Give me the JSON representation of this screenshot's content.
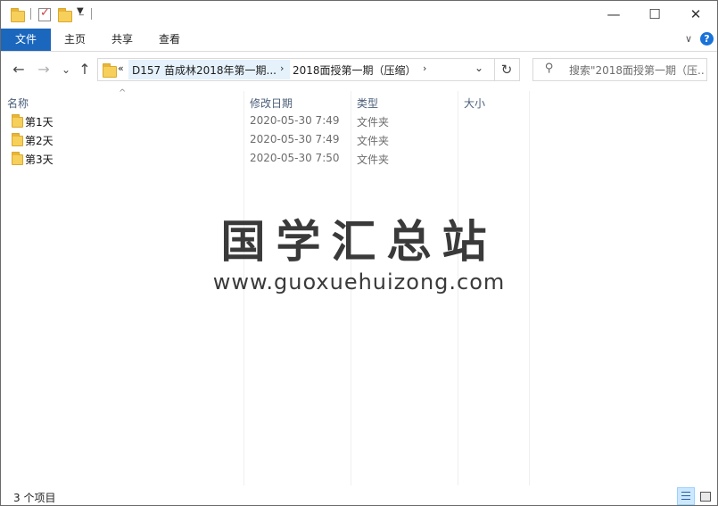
{
  "titlebar": {
    "window_controls": {
      "minimize": "—",
      "maximize": "☐",
      "close": "✕"
    }
  },
  "ribbon": {
    "tabs": [
      "文件",
      "主页",
      "共享",
      "查看"
    ],
    "help": "?"
  },
  "nav": {
    "back": "←",
    "forward": "→",
    "recent": "⌄",
    "up": "↑",
    "overflow": "«",
    "breadcrumbs": [
      "D157 苗成林2018年第一期...",
      "2018面授第一期（压缩）"
    ],
    "search_placeholder": "搜索\"2018面授第一期（压..."
  },
  "columns": {
    "name": "名称",
    "date": "修改日期",
    "type": "类型",
    "size": "大小"
  },
  "rows": [
    {
      "name": "第1天",
      "date": "2020-05-30 7:49",
      "type": "文件夹",
      "size": ""
    },
    {
      "name": "第2天",
      "date": "2020-05-30 7:49",
      "type": "文件夹",
      "size": ""
    },
    {
      "name": "第3天",
      "date": "2020-05-30 7:50",
      "type": "文件夹",
      "size": ""
    }
  ],
  "watermark": {
    "chinese": "国学汇总站",
    "url": "www.guoxuehuizong.com"
  },
  "status": {
    "item_count": "3 个项目"
  },
  "colors": {
    "accent": "#1b67bd",
    "folder": "#f7cf5b",
    "header_text": "#4c607a"
  }
}
